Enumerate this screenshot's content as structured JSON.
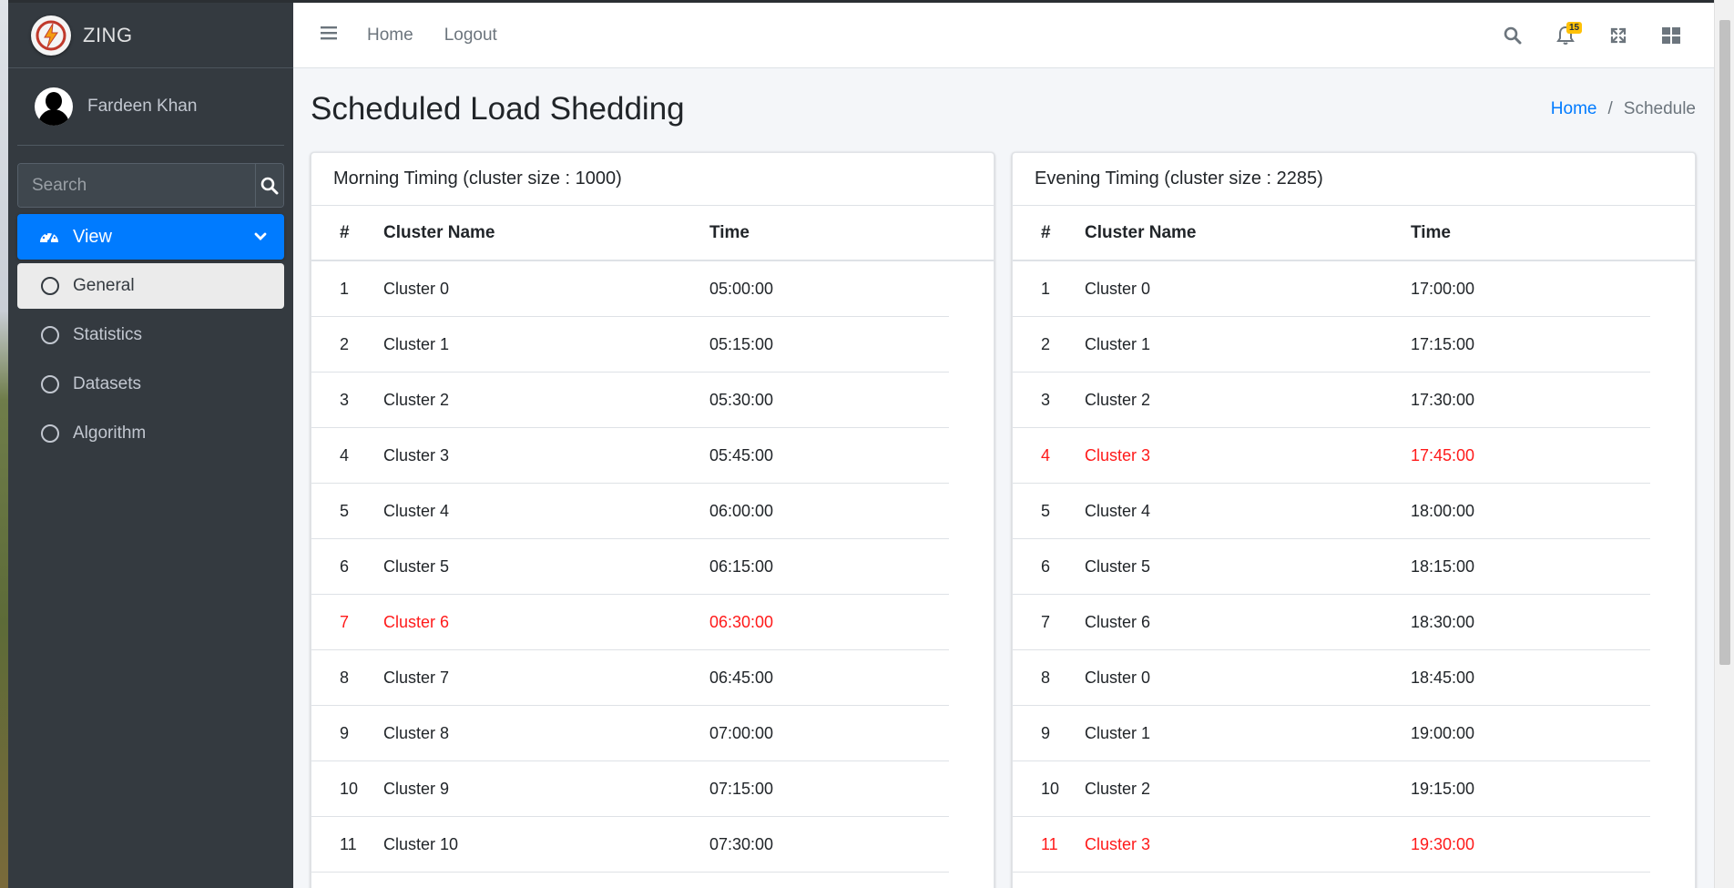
{
  "brand": {
    "name": "ZING"
  },
  "user": {
    "name": "Fardeen Khan"
  },
  "sidebar": {
    "search_placeholder": "Search",
    "nav_parent": {
      "label": "View",
      "icon": "tachometer-icon"
    },
    "items": [
      {
        "label": "General",
        "active": true
      },
      {
        "label": "Statistics",
        "active": false
      },
      {
        "label": "Datasets",
        "active": false
      },
      {
        "label": "Algorithm",
        "active": false
      }
    ]
  },
  "topbar": {
    "links": [
      "Home",
      "Logout"
    ],
    "notification_count": "15",
    "icons": [
      "search-icon",
      "bell-icon",
      "expand-icon",
      "grid-icon"
    ]
  },
  "page": {
    "title": "Scheduled Load Shedding",
    "breadcrumb": {
      "home": "Home",
      "separator": "/",
      "current": "Schedule"
    }
  },
  "table_headers": {
    "num": "#",
    "name": "Cluster Name",
    "time": "Time"
  },
  "colors": {
    "accent": "#007bff",
    "highlight": "#ff1a1a",
    "sidebar": "#343a40"
  },
  "morning": {
    "title": "Morning Timing (cluster size : 1000)",
    "rows": [
      {
        "num": "1",
        "name": "Cluster 0",
        "time": "05:00:00",
        "hl": false
      },
      {
        "num": "2",
        "name": "Cluster 1",
        "time": "05:15:00",
        "hl": false
      },
      {
        "num": "3",
        "name": "Cluster 2",
        "time": "05:30:00",
        "hl": false
      },
      {
        "num": "4",
        "name": "Cluster 3",
        "time": "05:45:00",
        "hl": false
      },
      {
        "num": "5",
        "name": "Cluster 4",
        "time": "06:00:00",
        "hl": false
      },
      {
        "num": "6",
        "name": "Cluster 5",
        "time": "06:15:00",
        "hl": false
      },
      {
        "num": "7",
        "name": "Cluster 6",
        "time": "06:30:00",
        "hl": true
      },
      {
        "num": "8",
        "name": "Cluster 7",
        "time": "06:45:00",
        "hl": false
      },
      {
        "num": "9",
        "name": "Cluster 8",
        "time": "07:00:00",
        "hl": false
      },
      {
        "num": "10",
        "name": "Cluster 9",
        "time": "07:15:00",
        "hl": false
      },
      {
        "num": "11",
        "name": "Cluster 10",
        "time": "07:30:00",
        "hl": false
      }
    ]
  },
  "evening": {
    "title": "Evening Timing (cluster size : 2285)",
    "rows": [
      {
        "num": "1",
        "name": "Cluster 0",
        "time": "17:00:00",
        "hl": false
      },
      {
        "num": "2",
        "name": "Cluster 1",
        "time": "17:15:00",
        "hl": false
      },
      {
        "num": "3",
        "name": "Cluster 2",
        "time": "17:30:00",
        "hl": false
      },
      {
        "num": "4",
        "name": "Cluster 3",
        "time": "17:45:00",
        "hl": true
      },
      {
        "num": "5",
        "name": "Cluster 4",
        "time": "18:00:00",
        "hl": false
      },
      {
        "num": "6",
        "name": "Cluster 5",
        "time": "18:15:00",
        "hl": false
      },
      {
        "num": "7",
        "name": "Cluster 6",
        "time": "18:30:00",
        "hl": false
      },
      {
        "num": "8",
        "name": "Cluster 0",
        "time": "18:45:00",
        "hl": false
      },
      {
        "num": "9",
        "name": "Cluster 1",
        "time": "19:00:00",
        "hl": false
      },
      {
        "num": "10",
        "name": "Cluster 2",
        "time": "19:15:00",
        "hl": false
      },
      {
        "num": "11",
        "name": "Cluster 3",
        "time": "19:30:00",
        "hl": true
      }
    ]
  }
}
